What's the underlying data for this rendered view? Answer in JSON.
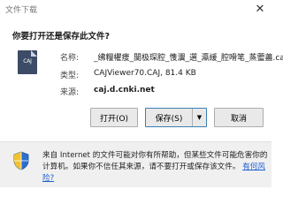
{
  "window": {
    "title": "文件下载",
    "close_glyph": "✕"
  },
  "question": "你要打开还是保存此文件?",
  "file": {
    "icon": "caj-file-icon",
    "icon_label": "CAJ",
    "name_label": "名称:",
    "name_value": "_绋糧欋痩_閬极琛腔_愯瀷_選_瀛緩_腔嗗笔_蒸藌藎.caj",
    "type_label": "类型:",
    "type_value": "CAJViewer70.CAJ, 81.4 KB",
    "source_label": "来源:",
    "source_value": "caj.d.cnki.net"
  },
  "buttons": {
    "open": "打开(O)",
    "save": "保存(S)",
    "save_dropdown": "▼",
    "cancel": "取消"
  },
  "footer": {
    "shield_icon": "security-shield-icon",
    "warning_text": "来自 Internet 的文件可能对你有所帮助，但某些文件可能危害你的计算机。如果你不信任其来源，请不要打开或保存该文件。",
    "link_text": "有何风险?"
  }
}
